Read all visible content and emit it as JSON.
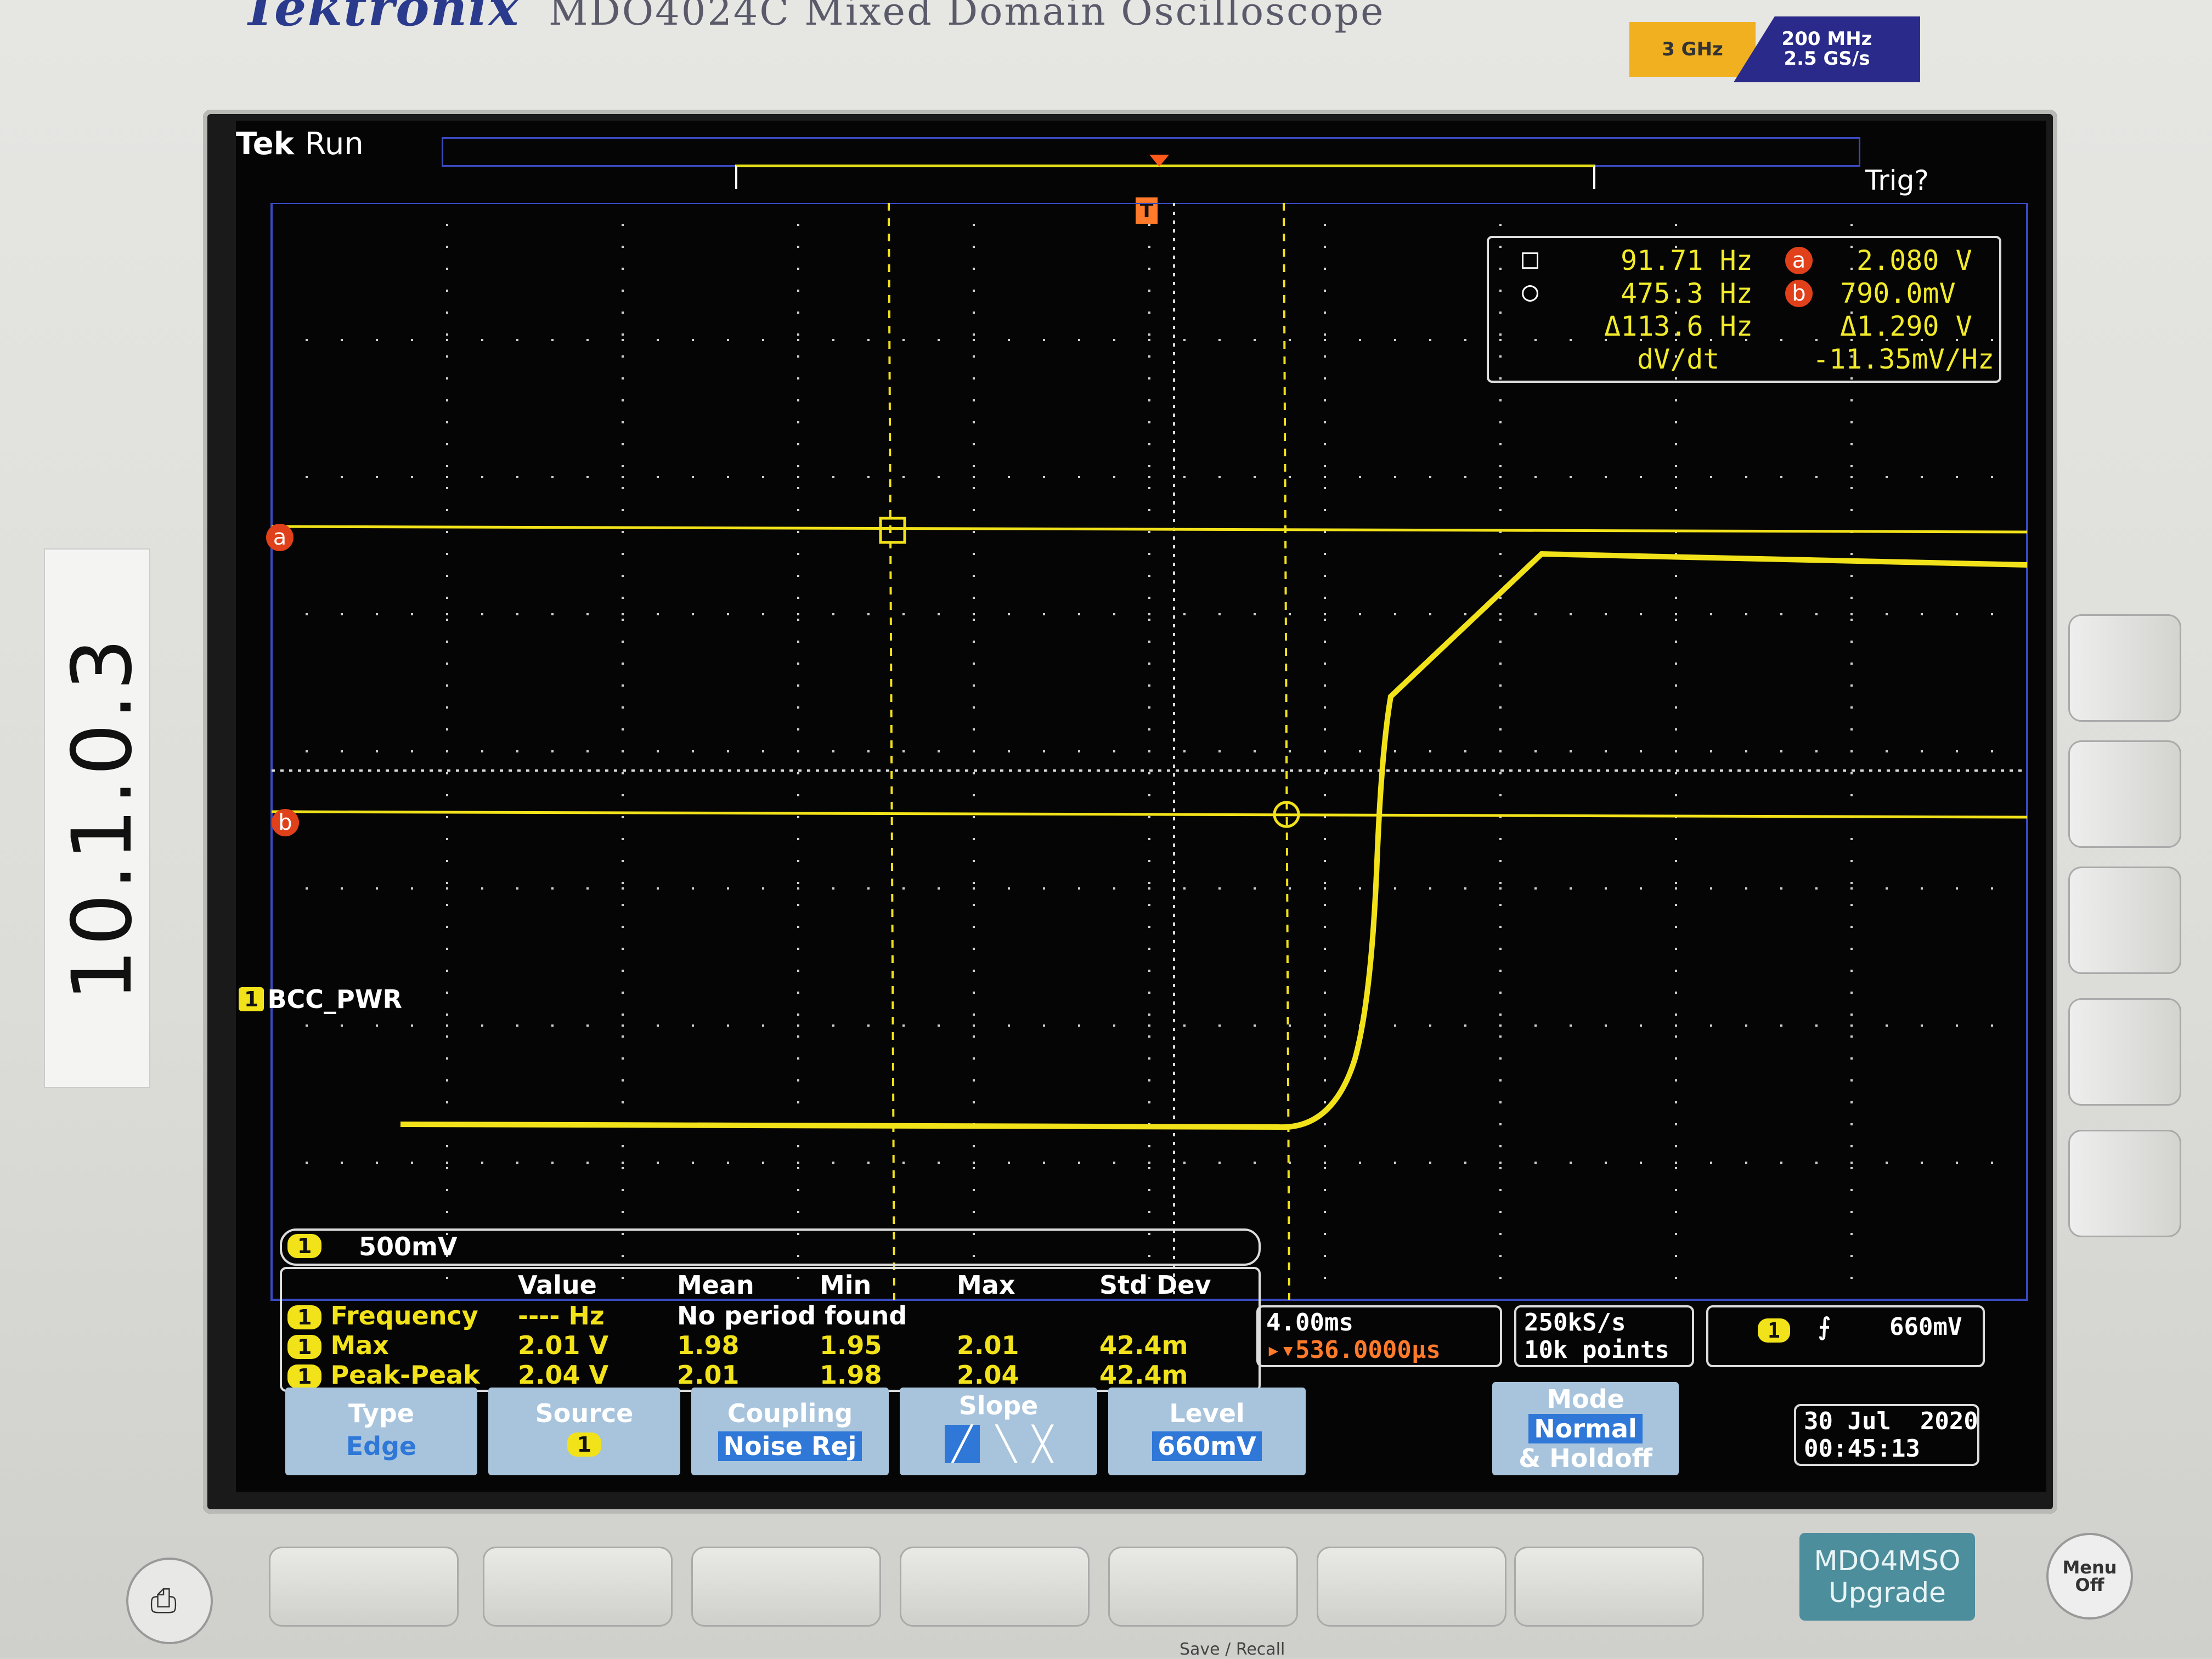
{
  "header": {
    "brand": "Tektronix",
    "model": "MDO4024C Mixed Domain Oscilloscope",
    "bandwidth_badge": "3 GHz",
    "spec_line1": "200 MHz",
    "spec_line2": "2.5 GS/s"
  },
  "side_label": "10.1.0.3",
  "screen": {
    "tek": "Tek",
    "status": "Run",
    "trigger_state": "Trig?",
    "trigger_marker": "T",
    "channel_label": "BCC_PWR",
    "channel_number": "1",
    "cursor_a_label": "a",
    "cursor_b_label": "b"
  },
  "cursor_readout": {
    "square_freq": "91.71 Hz",
    "circle_freq": "475.3 Hz",
    "delta_freq": "Δ113.6 Hz",
    "dvdt_label": "dV/dt",
    "a_value": "2.080 V",
    "b_value": "790.0mV",
    "delta_v": "Δ1.290 V",
    "dvdt_value": "-11.35mV/Hz"
  },
  "vertical_scale": {
    "channel": "1",
    "scale": "500mV"
  },
  "measurements": {
    "headers": [
      "Value",
      "Mean",
      "Min",
      "Max",
      "Std Dev"
    ],
    "rows": [
      {
        "ch": "1",
        "name": "Frequency",
        "value": "---- Hz",
        "mean": "No period found",
        "min": "",
        "max": "",
        "std": ""
      },
      {
        "ch": "1",
        "name": "Max",
        "value": "2.01 V",
        "mean": "1.98",
        "min": "1.95",
        "max": "2.01",
        "std": "42.4m"
      },
      {
        "ch": "1",
        "name": "Peak-Peak",
        "value": "2.04 V",
        "mean": "2.01",
        "min": "1.98",
        "max": "2.04",
        "std": "42.4m"
      }
    ]
  },
  "horizontal": {
    "timebase": "4.00ms",
    "delay": "▸▾536.0000µs"
  },
  "acquisition": {
    "rate": "250kS/s",
    "points": "10k points"
  },
  "trigger": {
    "channel": "1",
    "level": "660mV"
  },
  "softkeys": [
    {
      "title": "Type",
      "value": "Edge"
    },
    {
      "title": "Source",
      "value": "1"
    },
    {
      "title": "Coupling",
      "value": "Noise Rej"
    },
    {
      "title": "Slope",
      "value": ""
    },
    {
      "title": "Level",
      "value": "660mV"
    }
  ],
  "mode": {
    "title": "Mode",
    "value": "Normal",
    "sub": "& Holdoff"
  },
  "datetime": {
    "date": "30 Jul  2020",
    "time": "00:45:13"
  },
  "front_panel": {
    "upgrade_line1": "MDO4MSO",
    "upgrade_line2": "Upgrade",
    "menu_line1": "Menu",
    "menu_line2": "Off",
    "save_recall": "Save / Recall"
  },
  "colors": {
    "trace": "#f2e21a",
    "cursor_marker": "#e0401a",
    "trigger": "#ff7a2a",
    "softkey": "#a8c4dc",
    "softkey_value_bg": "#2f78d8"
  }
}
